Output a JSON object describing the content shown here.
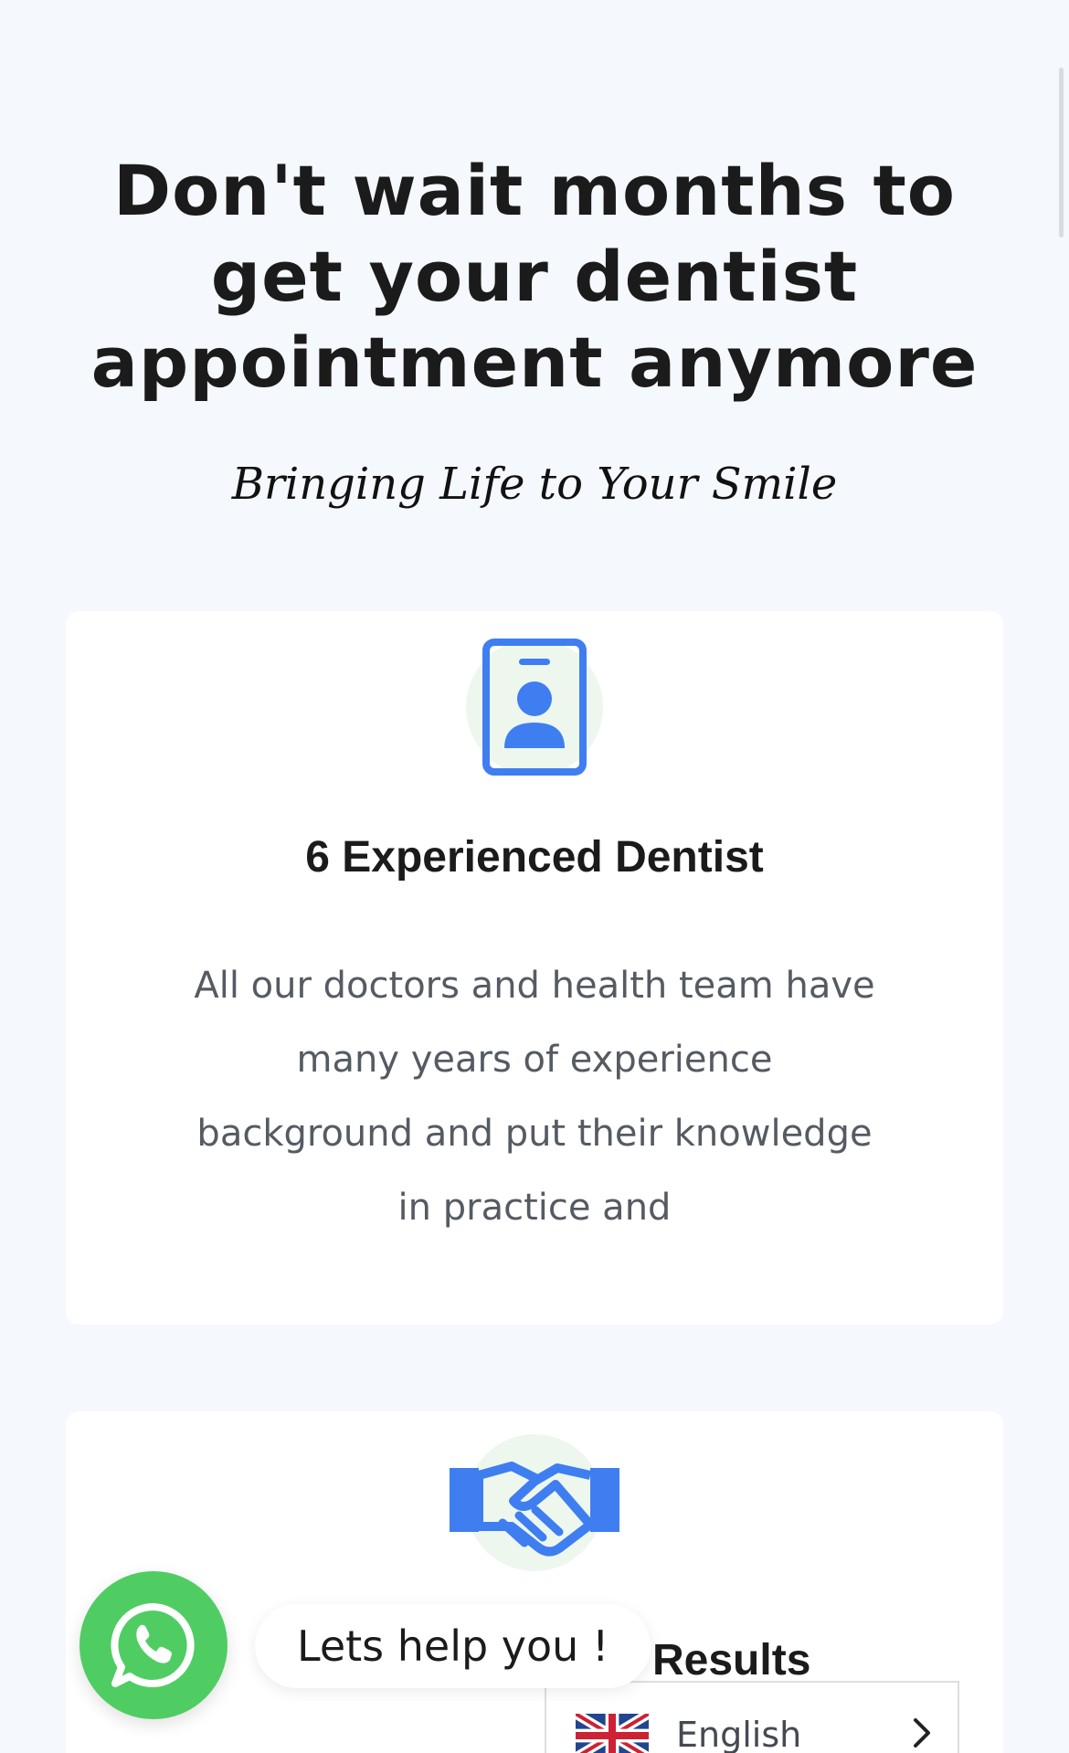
{
  "hero": {
    "title": "Don't wait months to get your dentist appointment anymore",
    "tagline": "Bringing Life to Your Smile"
  },
  "features": [
    {
      "icon": "id-badge-icon",
      "title": "6 Experienced Dentist",
      "text": "All our doctors and health team have many years of experience background and put their knowledge in practice and"
    },
    {
      "icon": "handshake-icon",
      "title": "Results"
    }
  ],
  "whatsapp": {
    "icon": "whatsapp-icon",
    "prompt": "Lets help you !"
  },
  "language": {
    "selected": "English",
    "flag": "uk-flag-icon"
  },
  "colors": {
    "accent": "#3f7ef0",
    "icon_bg": "#edf7ee",
    "whatsapp": "#4fcd63",
    "page_bg": "#f5f8fc"
  }
}
